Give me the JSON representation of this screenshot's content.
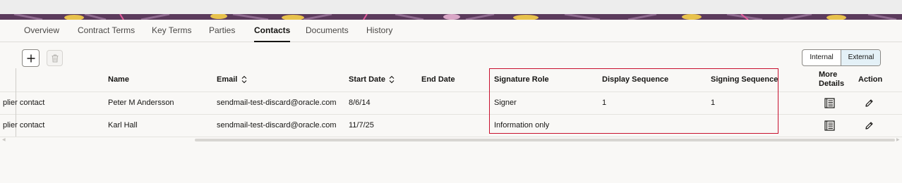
{
  "tabs": [
    {
      "label": "Overview",
      "active": false
    },
    {
      "label": "Contract Terms",
      "active": false
    },
    {
      "label": "Key Terms",
      "active": false
    },
    {
      "label": "Parties",
      "active": false
    },
    {
      "label": "Contacts",
      "active": true
    },
    {
      "label": "Documents",
      "active": false
    },
    {
      "label": "History",
      "active": false
    }
  ],
  "toolbar": {
    "add_icon": "plus-icon",
    "delete_icon": "trash-icon",
    "toggle": {
      "internal": "Internal",
      "external": "External",
      "selected": "External"
    }
  },
  "table": {
    "columns": {
      "name": "Name",
      "email": "Email",
      "start_date": "Start Date",
      "end_date": "End Date",
      "signature_role": "Signature Role",
      "display_sequence": "Display Sequence",
      "signing_sequence": "Signing Sequence",
      "more_details_1": "More",
      "more_details_2": "Details",
      "action": "Action"
    },
    "rows": [
      {
        "role": "plier contact",
        "name": "Peter M Andersson",
        "email": "sendmail-test-discard@oracle.com",
        "start_date": "8/6/14",
        "end_date": "",
        "signature_role": "Signer",
        "display_sequence": "1",
        "signing_sequence": "1"
      },
      {
        "role": "plier contact",
        "name": "Karl Hall",
        "email": "sendmail-test-discard@oracle.com",
        "start_date": "11/7/25",
        "end_date": "",
        "signature_role": "Information only",
        "display_sequence": "",
        "signing_sequence": ""
      }
    ]
  },
  "colors": {
    "highlight_border": "#c8102e",
    "selected_toggle": "#e4f1f7",
    "banner": "#5b3a5c"
  }
}
